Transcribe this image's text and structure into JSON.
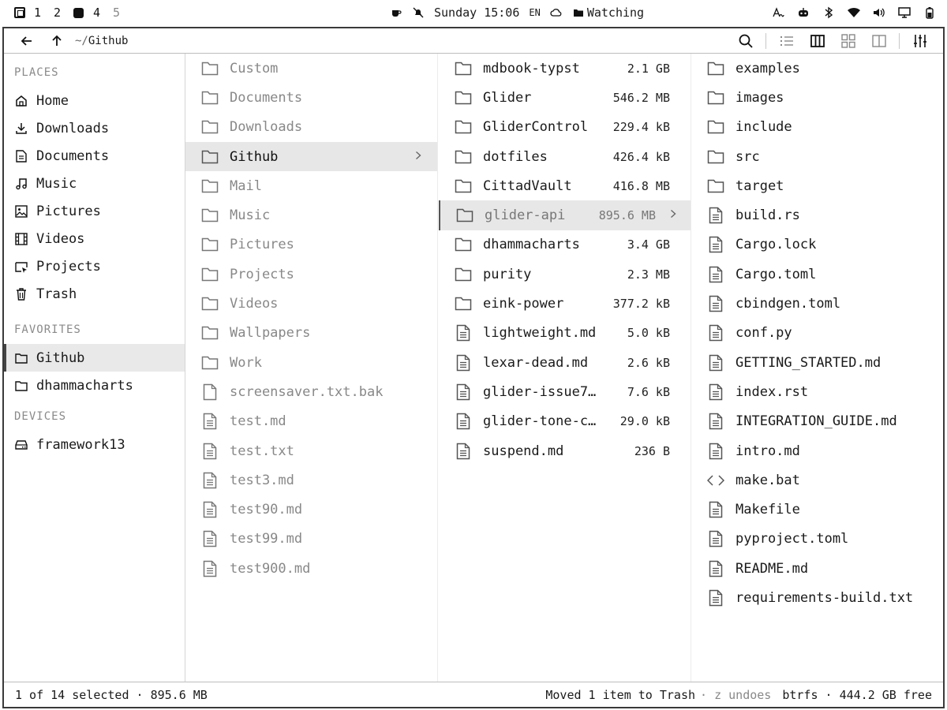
{
  "topbar": {
    "workspaces": [
      "1",
      "2",
      "4",
      "5"
    ],
    "clock": "Sunday 15:06",
    "lang": "EN",
    "status": "Watching",
    "icons": [
      "layout-icon",
      "workspace-active-icon",
      "coffee-icon",
      "bell-off-icon",
      "cloud-icon",
      "folder-icon",
      "text-icon",
      "robot-icon",
      "bluetooth-icon",
      "wifi-icon",
      "volume-icon",
      "monitor-icon",
      "battery-icon"
    ]
  },
  "toolbar": {
    "path_prefix": "~/",
    "path_name": "Github",
    "icons": [
      "back-arrow-icon",
      "up-arrow-icon",
      "search-icon",
      "list-view-icon",
      "columns-view-icon",
      "grid-view-icon",
      "split-view-icon",
      "settings-sliders-icon"
    ]
  },
  "sidebar": {
    "places_title": "PLACES",
    "places": [
      {
        "label": "Home",
        "icon": "home-icon"
      },
      {
        "label": "Downloads",
        "icon": "download-icon"
      },
      {
        "label": "Documents",
        "icon": "document-icon"
      },
      {
        "label": "Music",
        "icon": "music-icon"
      },
      {
        "label": "Pictures",
        "icon": "picture-icon"
      },
      {
        "label": "Videos",
        "icon": "video-icon"
      },
      {
        "label": "Projects",
        "icon": "projects-icon"
      },
      {
        "label": "Trash",
        "icon": "trash-icon"
      }
    ],
    "favorites_title": "FAVORITES",
    "favorites": [
      {
        "label": "Github",
        "icon": "folder-icon",
        "selected": true
      },
      {
        "label": "dhammacharts",
        "icon": "folder-icon"
      }
    ],
    "devices_title": "DEVICES",
    "devices": [
      {
        "label": "framework13",
        "icon": "drive-icon"
      }
    ]
  },
  "columns": {
    "col1": [
      {
        "name": "Custom",
        "type": "folder"
      },
      {
        "name": "Documents",
        "type": "folder"
      },
      {
        "name": "Downloads",
        "type": "folder"
      },
      {
        "name": "Github",
        "type": "folder",
        "selected": true
      },
      {
        "name": "Mail",
        "type": "folder"
      },
      {
        "name": "Music",
        "type": "folder"
      },
      {
        "name": "Pictures",
        "type": "folder"
      },
      {
        "name": "Projects",
        "type": "folder"
      },
      {
        "name": "Videos",
        "type": "folder"
      },
      {
        "name": "Wallpapers",
        "type": "folder"
      },
      {
        "name": "Work",
        "type": "folder"
      },
      {
        "name": "screensaver.txt.bak",
        "type": "blank"
      },
      {
        "name": "test.md",
        "type": "file"
      },
      {
        "name": "test.txt",
        "type": "file"
      },
      {
        "name": "test3.md",
        "type": "file"
      },
      {
        "name": "test90.md",
        "type": "file"
      },
      {
        "name": "test99.md",
        "type": "file"
      },
      {
        "name": "test900.md",
        "type": "file"
      }
    ],
    "col2": [
      {
        "name": "mdbook-typst",
        "type": "folder",
        "size": "2.1 GB"
      },
      {
        "name": "Glider",
        "type": "folder",
        "size": "546.2 MB"
      },
      {
        "name": "GliderControl",
        "type": "folder",
        "size": "229.4 kB"
      },
      {
        "name": "dotfiles",
        "type": "folder",
        "size": "426.4 kB"
      },
      {
        "name": "CittadVault",
        "type": "folder",
        "size": "416.8 MB"
      },
      {
        "name": "glider-api",
        "type": "folder",
        "size": "895.6 MB",
        "selected": true
      },
      {
        "name": "dhammacharts",
        "type": "folder",
        "size": "3.4 GB"
      },
      {
        "name": "purity",
        "type": "folder",
        "size": "2.3 MB"
      },
      {
        "name": "eink-power",
        "type": "folder",
        "size": "377.2 kB"
      },
      {
        "name": "lightweight.md",
        "type": "file",
        "size": "5.0 kB"
      },
      {
        "name": "lexar-dead.md",
        "type": "file",
        "size": "2.6 kB"
      },
      {
        "name": "glider-issue7…",
        "type": "file",
        "size": "7.6 kB"
      },
      {
        "name": "glider-tone-c…",
        "type": "file",
        "size": "29.0 kB"
      },
      {
        "name": "suspend.md",
        "type": "file",
        "size": "236 B"
      }
    ],
    "col3": [
      {
        "name": "examples",
        "type": "folder"
      },
      {
        "name": "images",
        "type": "folder"
      },
      {
        "name": "include",
        "type": "folder"
      },
      {
        "name": "src",
        "type": "folder"
      },
      {
        "name": "target",
        "type": "folder"
      },
      {
        "name": "build.rs",
        "type": "file"
      },
      {
        "name": "Cargo.lock",
        "type": "file"
      },
      {
        "name": "Cargo.toml",
        "type": "file"
      },
      {
        "name": "cbindgen.toml",
        "type": "file"
      },
      {
        "name": "conf.py",
        "type": "file"
      },
      {
        "name": "GETTING_STARTED.md",
        "type": "file"
      },
      {
        "name": "index.rst",
        "type": "file"
      },
      {
        "name": "INTEGRATION_GUIDE.md",
        "type": "file"
      },
      {
        "name": "intro.md",
        "type": "file"
      },
      {
        "name": "make.bat",
        "type": "code"
      },
      {
        "name": "Makefile",
        "type": "file"
      },
      {
        "name": "pyproject.toml",
        "type": "file"
      },
      {
        "name": "README.md",
        "type": "file"
      },
      {
        "name": "requirements-build.txt",
        "type": "file"
      }
    ]
  },
  "statusbar": {
    "selection": "1 of 14 selected · 895.6 MB",
    "message": "Moved 1 item to Trash",
    "undo_hint": "· z undoes",
    "fs": "btrfs · 444.2 GB free"
  }
}
